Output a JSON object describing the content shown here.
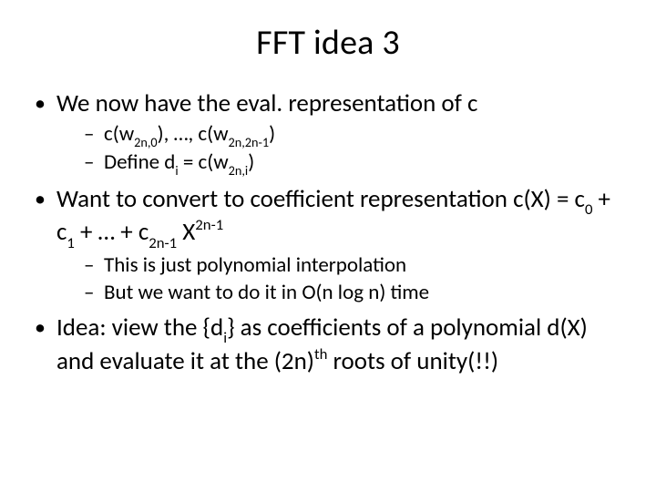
{
  "title": "FFT idea 3",
  "b1": {
    "text": "We now have the eval. representation of c",
    "s1a": "c(w",
    "s1b": "2n,0",
    "s1c": "), …, c(w",
    "s1d": "2n,2n-1",
    "s1e": ")",
    "s2a": "Define d",
    "s2b": "i",
    "s2c": " = c(w",
    "s2d": "2n,i",
    "s2e": ")"
  },
  "b2": {
    "l1a": " Want to convert to coefficient representation c(X) = c",
    "l1b": "0",
    "l1c": " + c",
    "l1d": "1",
    "l1e": " + … + c",
    "l1f": "2n-1",
    "l1g": " X",
    "l1h": "2n-1",
    "s1": "This is just polynomial interpolation",
    "s2": "But we want to do it in O(n log n) time"
  },
  "b3": {
    "a": "Idea: view the {d",
    "b": "i",
    "c": "} as coefficients of a polynomial d(X) and evaluate it at the (2n)",
    "d": "th",
    "e": " roots of unity(!!)"
  }
}
